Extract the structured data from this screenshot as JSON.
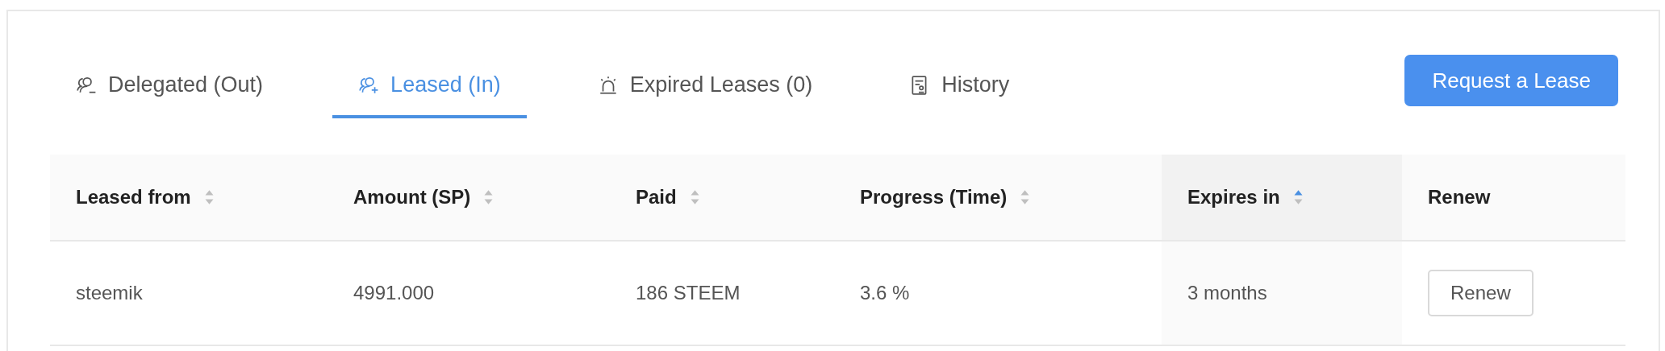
{
  "tabs": [
    {
      "label": "Delegated (Out)",
      "selected": false
    },
    {
      "label": "Leased (In)",
      "selected": true
    },
    {
      "label": "Expired Leases (0)",
      "selected": false
    },
    {
      "label": "History",
      "selected": false
    }
  ],
  "request_button": "Request a Lease",
  "table": {
    "columns": [
      {
        "label": "Leased from",
        "sortable": true,
        "sorted": false
      },
      {
        "label": "Amount (SP)",
        "sortable": true,
        "sorted": false
      },
      {
        "label": "Paid",
        "sortable": true,
        "sorted": false
      },
      {
        "label": "Progress (Time)",
        "sortable": true,
        "sorted": false
      },
      {
        "label": "Expires in",
        "sortable": true,
        "sorted": true
      },
      {
        "label": "Renew",
        "sortable": false,
        "sorted": false
      }
    ],
    "rows": [
      {
        "cells": [
          "steemik",
          "4991.000",
          "186 STEEM",
          "3.6 %",
          "3 months"
        ],
        "action": "Renew"
      }
    ]
  }
}
